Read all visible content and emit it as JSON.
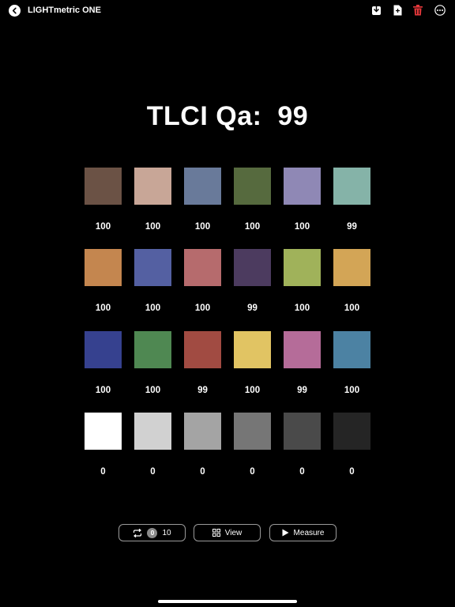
{
  "header": {
    "title": "LIGHTmetric ONE",
    "icons": [
      "back-icon",
      "download-icon",
      "document-icon",
      "trash-icon",
      "more-icon"
    ],
    "trash_color": "#e5383b"
  },
  "headline": {
    "label": "TLCI Qa:",
    "value": "99"
  },
  "swatches": [
    {
      "color": "#6b5245",
      "score": "100"
    },
    {
      "color": "#c8a697",
      "score": "100"
    },
    {
      "color": "#697a9a",
      "score": "100"
    },
    {
      "color": "#566a3e",
      "score": "100"
    },
    {
      "color": "#8f88b5",
      "score": "100"
    },
    {
      "color": "#85b3a8",
      "score": "99"
    },
    {
      "color": "#c4864f",
      "score": "100"
    },
    {
      "color": "#5460a2",
      "score": "100"
    },
    {
      "color": "#b66b6d",
      "score": "100"
    },
    {
      "color": "#4c3b5f",
      "score": "99"
    },
    {
      "color": "#a0b25a",
      "score": "100"
    },
    {
      "color": "#d3a556",
      "score": "100"
    },
    {
      "color": "#36418f",
      "score": "100"
    },
    {
      "color": "#4f8852",
      "score": "100"
    },
    {
      "color": "#a14b42",
      "score": "99"
    },
    {
      "color": "#e1c463",
      "score": "100"
    },
    {
      "color": "#b56c99",
      "score": "99"
    },
    {
      "color": "#4c82a3",
      "score": "100"
    },
    {
      "color": "#ffffff",
      "score": "0"
    },
    {
      "color": "#d1d1d1",
      "score": "0"
    },
    {
      "color": "#a4a4a4",
      "score": "0"
    },
    {
      "color": "#767676",
      "score": "0"
    },
    {
      "color": "#4a4a4a",
      "score": "0"
    },
    {
      "color": "#252525",
      "score": "0"
    }
  ],
  "bottom": {
    "repeat": {
      "icon": "repeat-icon",
      "badge": "0",
      "count": "10"
    },
    "view": {
      "icon": "grid-icon",
      "label": "View"
    },
    "measure": {
      "icon": "play-icon",
      "label": "Measure"
    }
  }
}
